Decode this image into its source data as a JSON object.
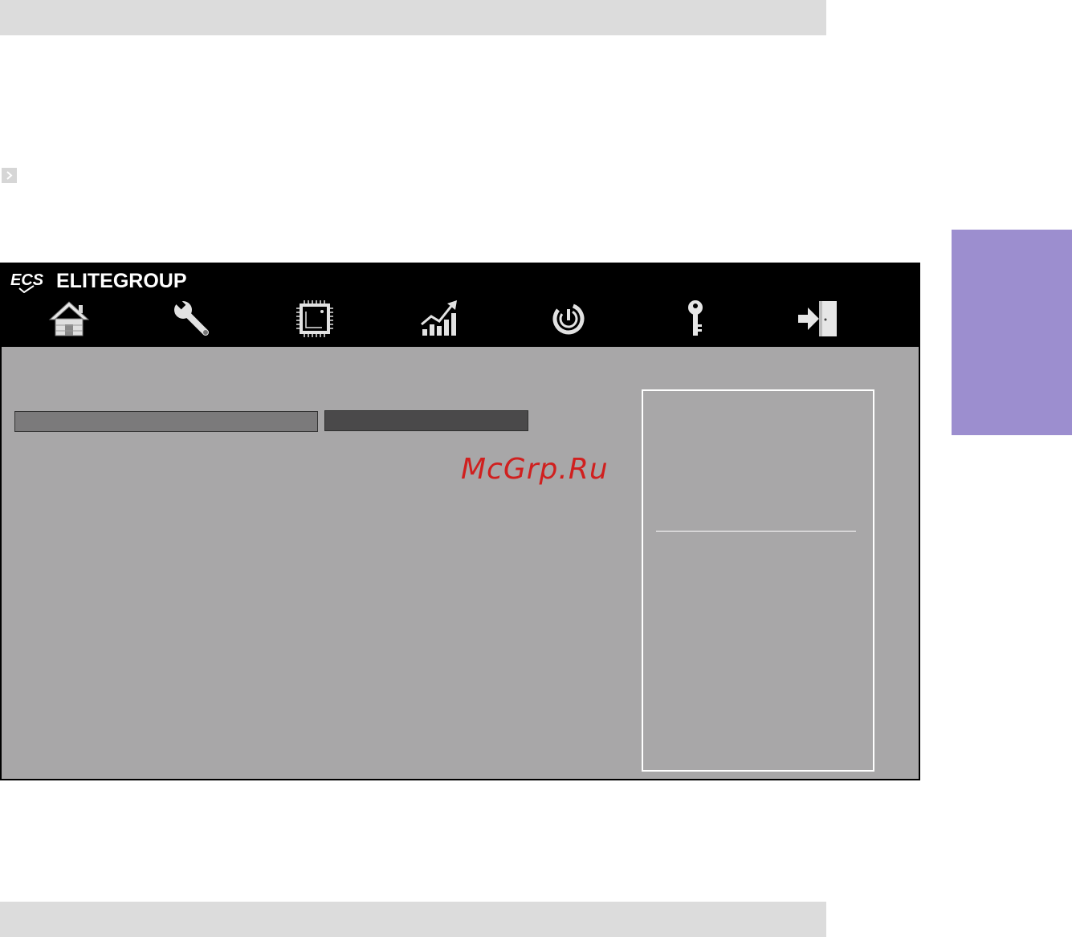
{
  "header": {
    "brand_name": "ELITEGROUP",
    "logo_mark": "ECS"
  },
  "nav": {
    "items": [
      {
        "name": "main",
        "icon": "home-icon"
      },
      {
        "name": "advanced",
        "icon": "wrench-icon"
      },
      {
        "name": "chipset",
        "icon": "chip-icon"
      },
      {
        "name": "performance",
        "icon": "chart-up-icon"
      },
      {
        "name": "boot",
        "icon": "power-icon"
      },
      {
        "name": "security",
        "icon": "key-icon"
      },
      {
        "name": "exit",
        "icon": "exit-icon"
      }
    ]
  },
  "watermark": "McGrp.Ru",
  "colors": {
    "header_bg": "#000000",
    "body_bg": "#a8a7a8",
    "field_light": "#7b7a7b",
    "field_dark": "#4a494a",
    "side_tab": "#9c8ecf",
    "watermark": "#d0201f"
  }
}
